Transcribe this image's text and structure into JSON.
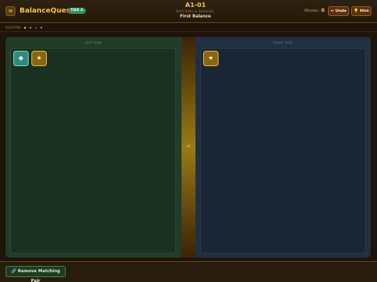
{
  "header": {
    "menu_icon": "≡",
    "app_title": "BalanceQuest",
    "tier_badge": "TIER A",
    "level_code": "A1-01",
    "level_category": "MATCHING & REMOVAL",
    "level_name": "First Balance",
    "moves_label": "Moves:",
    "moves_value": "0",
    "undo_label": "↩ Undo",
    "hint_label": "💡 Hint"
  },
  "equation": {
    "label": "EQUATION:",
    "symbols": [
      "◆",
      "★",
      "=",
      "★"
    ]
  },
  "board": {
    "left_label": "LEFT SIDE",
    "right_label": "RIGHT SIDE",
    "beam_symbol": "=",
    "left_tiles": [
      {
        "glyph": "◆",
        "kind": "diamond"
      },
      {
        "glyph": "★",
        "kind": "star"
      }
    ],
    "right_tiles": [
      {
        "glyph": "★",
        "kind": "star"
      }
    ]
  },
  "footer": {
    "remove_pair_label": "🔗 Remove Matching Pair"
  },
  "colors": {
    "accent_gold": "#f2c94c",
    "left_side": "#213d29",
    "right_side": "#212f43"
  }
}
